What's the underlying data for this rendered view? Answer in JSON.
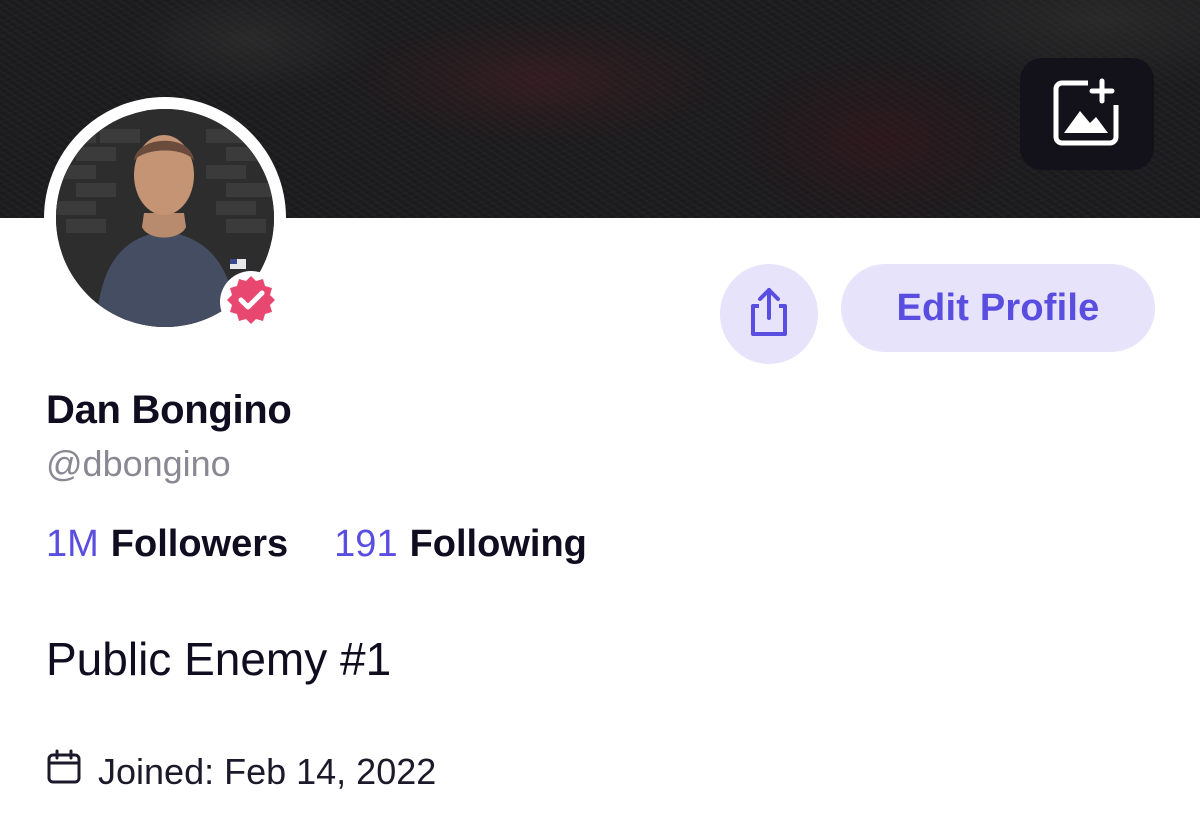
{
  "profile": {
    "display_name": "Dan Bongino",
    "handle": "@dbongino",
    "bio": "Public Enemy #1",
    "joined": "Joined: Feb 14, 2022",
    "verified": true
  },
  "stats": {
    "followers_count": "1M",
    "followers_label": "Followers",
    "following_count": "191",
    "following_label": "Following"
  },
  "actions": {
    "edit_profile_label": "Edit Profile"
  },
  "icons": {
    "banner_upload": "image-add-icon",
    "share": "share-icon",
    "verified": "verified-badge-icon",
    "joined": "calendar-icon"
  },
  "colors": {
    "accent": "#5a4ee0",
    "accent_soft": "#e6e3fb",
    "verified": "#e8486f",
    "muted_text": "#8a8893"
  }
}
